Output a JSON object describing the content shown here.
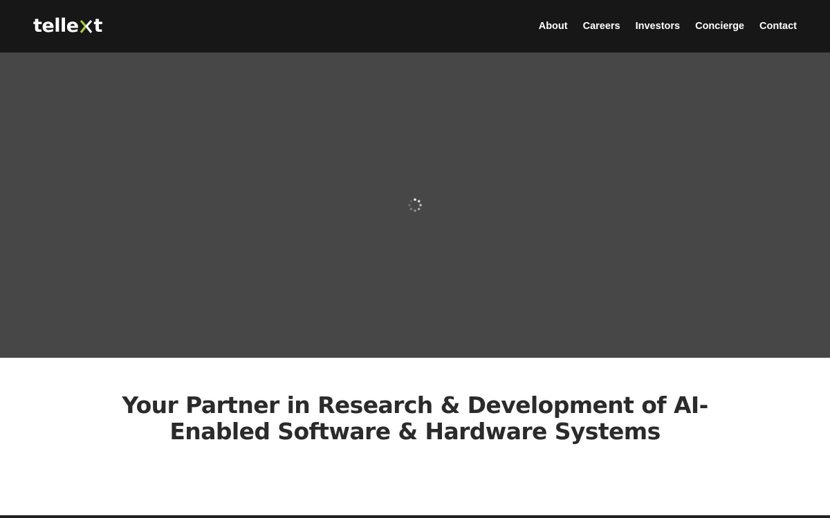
{
  "brand": {
    "logo_prefix": "telle",
    "logo_suffix": "t",
    "logo_text": "tellext",
    "accent_color": "#a6ce39"
  },
  "nav": {
    "items": [
      {
        "label": "About"
      },
      {
        "label": "Careers"
      },
      {
        "label": "Investors"
      },
      {
        "label": "Concierge"
      },
      {
        "label": "Contact"
      }
    ]
  },
  "hero": {
    "state_icon": "loading-spinner-icon",
    "background_color": "#474747"
  },
  "main": {
    "headline": "Your Partner in Research & Development of AI-Enabled Software & Hardware Systems"
  }
}
